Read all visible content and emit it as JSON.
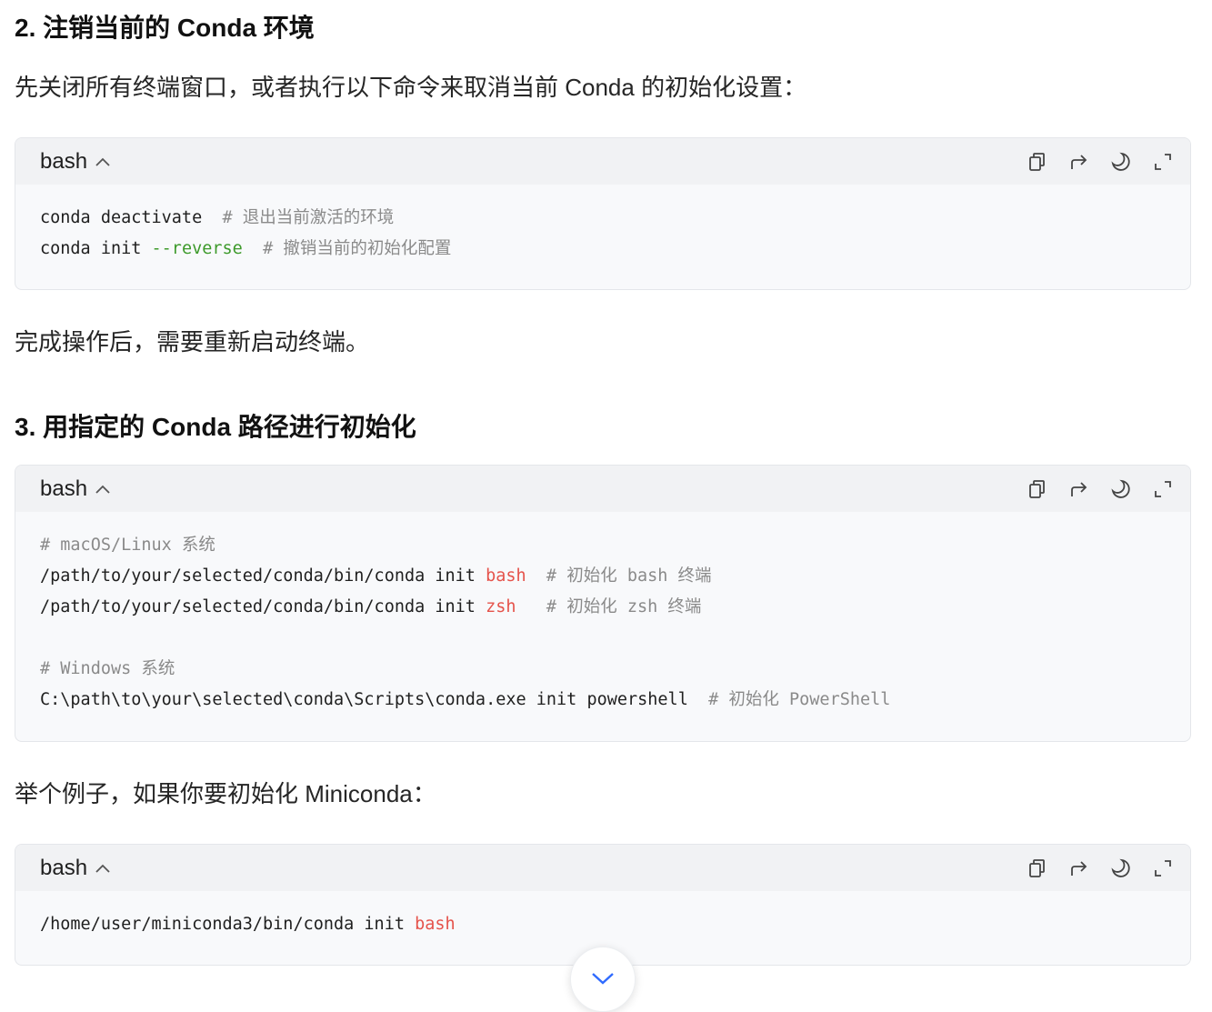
{
  "sections": {
    "s2_title": "2. 注销当前的 Conda 环境",
    "s2_intro": "先关闭所有终端窗口，或者执行以下命令来取消当前 Conda 的初始化设置：",
    "s2_after": "完成操作后，需要重新启动终端。",
    "s3_title": "3. 用指定的 Conda 路径进行初始化",
    "s3_example": "举个例子，如果你要初始化 Miniconda："
  },
  "code_blocks": [
    {
      "language": "bash",
      "lines": [
        [
          {
            "text": "conda deactivate  ",
            "type": "plain"
          },
          {
            "text": "# 退出当前激活的环境",
            "type": "comment"
          }
        ],
        [
          {
            "text": "conda init ",
            "type": "plain"
          },
          {
            "text": "--reverse",
            "type": "flag"
          },
          {
            "text": "  ",
            "type": "plain"
          },
          {
            "text": "# 撤销当前的初始化配置",
            "type": "comment"
          }
        ]
      ]
    },
    {
      "language": "bash",
      "lines": [
        [
          {
            "text": "# macOS/Linux 系统",
            "type": "comment"
          }
        ],
        [
          {
            "text": "/path/to/your/selected/conda/bin/conda init ",
            "type": "plain"
          },
          {
            "text": "bash",
            "type": "keyword"
          },
          {
            "text": "  ",
            "type": "plain"
          },
          {
            "text": "# 初始化 bash 终端",
            "type": "comment"
          }
        ],
        [
          {
            "text": "/path/to/your/selected/conda/bin/conda init ",
            "type": "plain"
          },
          {
            "text": "zsh",
            "type": "keyword"
          },
          {
            "text": "   ",
            "type": "plain"
          },
          {
            "text": "# 初始化 zsh 终端",
            "type": "comment"
          }
        ],
        [],
        [
          {
            "text": "# Windows 系统",
            "type": "comment"
          }
        ],
        [
          {
            "text": "C:\\path\\to\\your\\selected\\conda\\Scripts\\conda.exe init powershell  ",
            "type": "plain"
          },
          {
            "text": "# 初始化 PowerShell",
            "type": "comment"
          }
        ]
      ]
    },
    {
      "language": "bash",
      "lines": [
        [
          {
            "text": "/home/user/miniconda3/bin/conda init ",
            "type": "plain"
          },
          {
            "text": "bash",
            "type": "keyword"
          }
        ]
      ]
    }
  ],
  "toolbar_icons": [
    "copy-icon",
    "wrap-lines-icon",
    "theme-toggle-icon",
    "expand-icon"
  ],
  "colors": {
    "comment": "#8a8a8a",
    "flag": "#3d9a2b",
    "keyword": "#e5534b",
    "scroll_chevron": "#2f6bff"
  }
}
